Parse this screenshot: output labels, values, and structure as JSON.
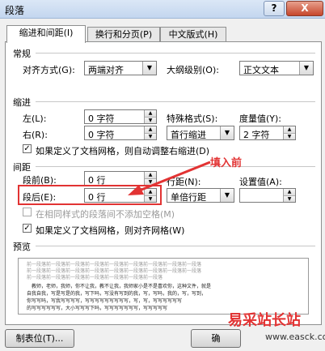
{
  "window": {
    "title": "段落",
    "help": "?",
    "close": "X"
  },
  "tabs": [
    "缩进和间距(I)",
    "换行和分页(P)",
    "中文版式(H)"
  ],
  "general": {
    "heading": "常规",
    "alignment_label": "对齐方式(G):",
    "alignment_value": "两端对齐",
    "outline_label": "大纲级别(O):",
    "outline_value": "正文文本"
  },
  "indent": {
    "heading": "缩进",
    "left_label": "左(L):",
    "left_value": "0 字符",
    "right_label": "右(R):",
    "right_value": "0 字符",
    "special_label": "特殊格式(S):",
    "special_value": "首行缩进",
    "measure_label": "度量值(Y):",
    "measure_value": "2 字符",
    "autoadjust_label": "如果定义了文档网格，则自动调整右缩进(D)"
  },
  "spacing": {
    "heading": "间距",
    "before_label": "段前(B):",
    "before_value": "0 行",
    "after_label": "段后(E):",
    "after_value": "0 行",
    "linespacing_label": "行距(N):",
    "linespacing_value": "单倍行距",
    "setvalue_label": "设置值(A):",
    "nospace_label": "在相同样式的段落间不添加空格(M)",
    "snapgrid_label": "如果定义了文档网格，则对齐网格(W)"
  },
  "preview": {
    "heading": "预览",
    "lines": [
      "前一段落前一段落前一段落前一段落前一段落前一段落前一段落前一段落前一段落",
      "前一段落前一段落前一段落前一段落前一段落前一段落前一段落前一段落前一段落",
      "前一段落前一段落前一段落前一段落前一段落前一段落前一段落",
      "教师，老师，我师，你不让我，教不让我，我师家小是不是喜欢你，这种文件，就是",
      "自我自我，写是写是的我，写下吗，写没有写到的我，写，写吗，我的，写，写到，",
      "你写写吗，写我写写写写，写写写写写写写写写，写，写，写写写写写写",
      "的写写写写写写，大小写写写下吗，写写写写写写写，写写写写写"
    ]
  },
  "buttons": {
    "tabs_button": "制表位(T)...",
    "ok_partial": "确"
  },
  "annotation": {
    "text": "填入前",
    "color": "#e23333"
  },
  "watermark": {
    "text": "易采站长站",
    "url": "www.easck.com"
  }
}
